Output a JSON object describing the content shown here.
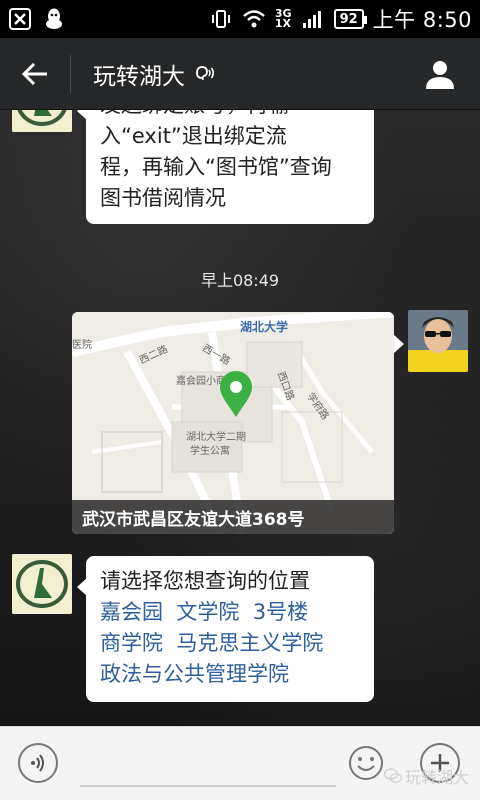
{
  "status_bar": {
    "network": "3G",
    "network_sub": "1X",
    "battery": "92",
    "time": "上午 8:50"
  },
  "header": {
    "title": "玩转湖大"
  },
  "messages": {
    "first": {
      "line0": "发送绑定账号，再输",
      "line1": "入“exit”退出绑定流",
      "line2": "程，再输入“图书馆”查询",
      "line3": "图书借阅情况"
    },
    "timestamp": "早上08:49",
    "location": {
      "address": "武汉市武昌区友谊大道368号",
      "map_labels": {
        "hubei_university": "湖北大学",
        "hospital": "医院",
        "xi_er_road": "西二路",
        "xi_yi_road": "西一路",
        "jiahuiyuan": "嘉会园小商城",
        "xi_road": "西口路",
        "xuefu_road": "学府路",
        "dorm_line1": "湖北大学二期",
        "dorm_line2": "学生公寓"
      }
    },
    "last": {
      "prompt": "请选择您想查询的位置",
      "options_line1": [
        "嘉会园",
        "文学院",
        "3号楼"
      ],
      "options_line2": [
        "商学院",
        "马克思主义学院"
      ],
      "options_line3": [
        "政法与公共管理学院"
      ]
    }
  },
  "watermark": "玩转湖大",
  "colors": {
    "link": "#2e5e9e",
    "map_pin": "#3cb043",
    "title_bar": "#252728"
  },
  "icons": {
    "back": "arrow-left-icon",
    "profile": "person-icon",
    "voice": "voice-icon",
    "emoji": "smiley-icon",
    "add": "plus-icon"
  }
}
